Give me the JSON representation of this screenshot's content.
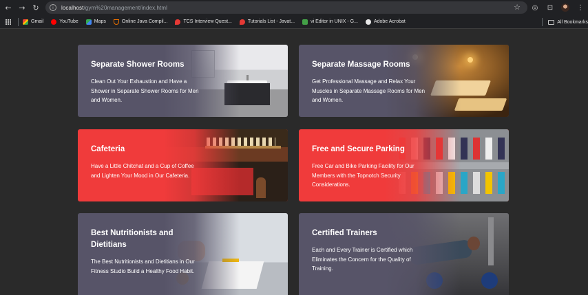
{
  "browser": {
    "nav": {
      "back_icon": "back-arrow-icon",
      "forward_icon": "forward-arrow-icon",
      "reload_icon": "reload-icon"
    },
    "url_host": "localhost",
    "url_path": "/gym%20management/index.html",
    "bookmarks": [
      {
        "label": "Gmail",
        "icon": "gmail-icon"
      },
      {
        "label": "YouTube",
        "icon": "youtube-icon"
      },
      {
        "label": "Maps",
        "icon": "maps-icon"
      },
      {
        "label": "Online Java Compil...",
        "icon": "java-icon"
      },
      {
        "label": "TCS Interview Quest...",
        "icon": "tcs-icon"
      },
      {
        "label": "Tutorials List - Javat...",
        "icon": "javatpoint-icon"
      },
      {
        "label": "vi Editor in UNIX - G...",
        "icon": "gfg-icon"
      },
      {
        "label": "Adobe Acrobat",
        "icon": "acrobat-icon"
      }
    ],
    "all_bookmarks": "All Bookmarks"
  },
  "services": [
    {
      "title": "Separate Shower Rooms",
      "desc": "Clean Out Your Exhaustion and Have a Shower in Separate Shower Rooms for Men and Women.",
      "theme": "gray"
    },
    {
      "title": "Separate Massage Rooms",
      "desc": "Get Professional Massage and Relax Your Muscles in Separate Massage Rooms for Men and Women.",
      "theme": "gray"
    },
    {
      "title": "Cafeteria",
      "desc": "Have a Little Chitchat and a Cup of Coffee and Lighten Your Mood in Our Cafeteria.",
      "theme": "red"
    },
    {
      "title": "Free and Secure Parking",
      "desc": "Free Car and Bike Parking Facility for Our Members with the Topnotch Security Considerations.",
      "theme": "red"
    },
    {
      "title": "Best Nutritionists and Dietitians",
      "desc": "The Best Nutritionists and Dietitians in Our Fitness Studio Build a Healthy Food Habit.",
      "theme": "gray"
    },
    {
      "title": "Certified Trainers",
      "desc": "Each and Every Trainer is Certified which Eliminates the Concern for the Quality of Training.",
      "theme": "gray"
    }
  ],
  "colors": {
    "gray_card": "#575468",
    "red_card": "#f03b3b",
    "page_bg": "#2a2a2a"
  }
}
